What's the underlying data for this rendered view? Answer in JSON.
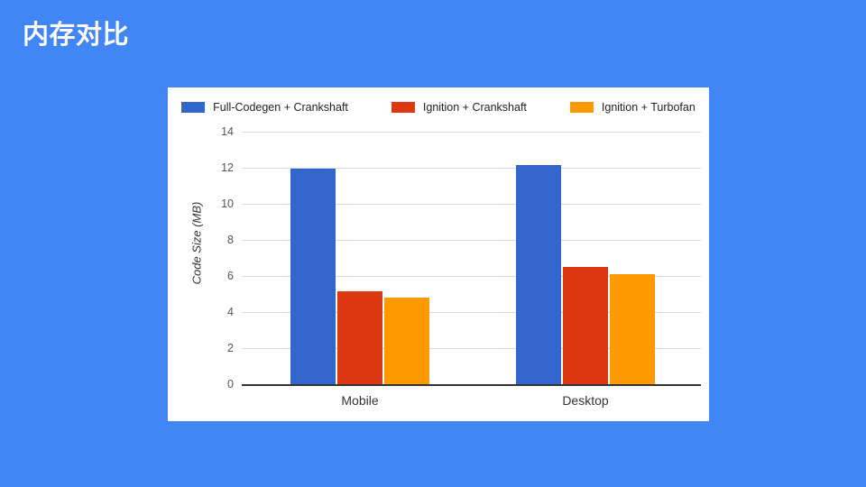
{
  "slide": {
    "title": "内存对比",
    "background_color": "#4285f4",
    "card_background": "#ffffff"
  },
  "chart_data": {
    "type": "bar",
    "title": "",
    "xlabel": "",
    "ylabel": "Code Size (MB)",
    "categories": [
      "Mobile",
      "Desktop"
    ],
    "series": [
      {
        "name": "Full-Codegen + Crankshaft",
        "color": "#3366cc",
        "values": [
          11.95,
          12.15
        ]
      },
      {
        "name": "Ignition + Crankshaft",
        "color": "#dc3912",
        "values": [
          5.15,
          6.5
        ]
      },
      {
        "name": "Ignition + Turbofan",
        "color": "#ff9900",
        "values": [
          4.8,
          6.1
        ]
      }
    ],
    "ylim": [
      0,
      14
    ],
    "yticks": [
      0,
      2,
      4,
      6,
      8,
      10,
      12,
      14
    ],
    "ytick_labels": [
      "0",
      "2",
      "4",
      "6",
      "8",
      "10",
      "12",
      "14"
    ],
    "grid": true,
    "legend_position": "top-center",
    "axis_color": "#333333",
    "gridline_color": "#d9d9d9"
  }
}
